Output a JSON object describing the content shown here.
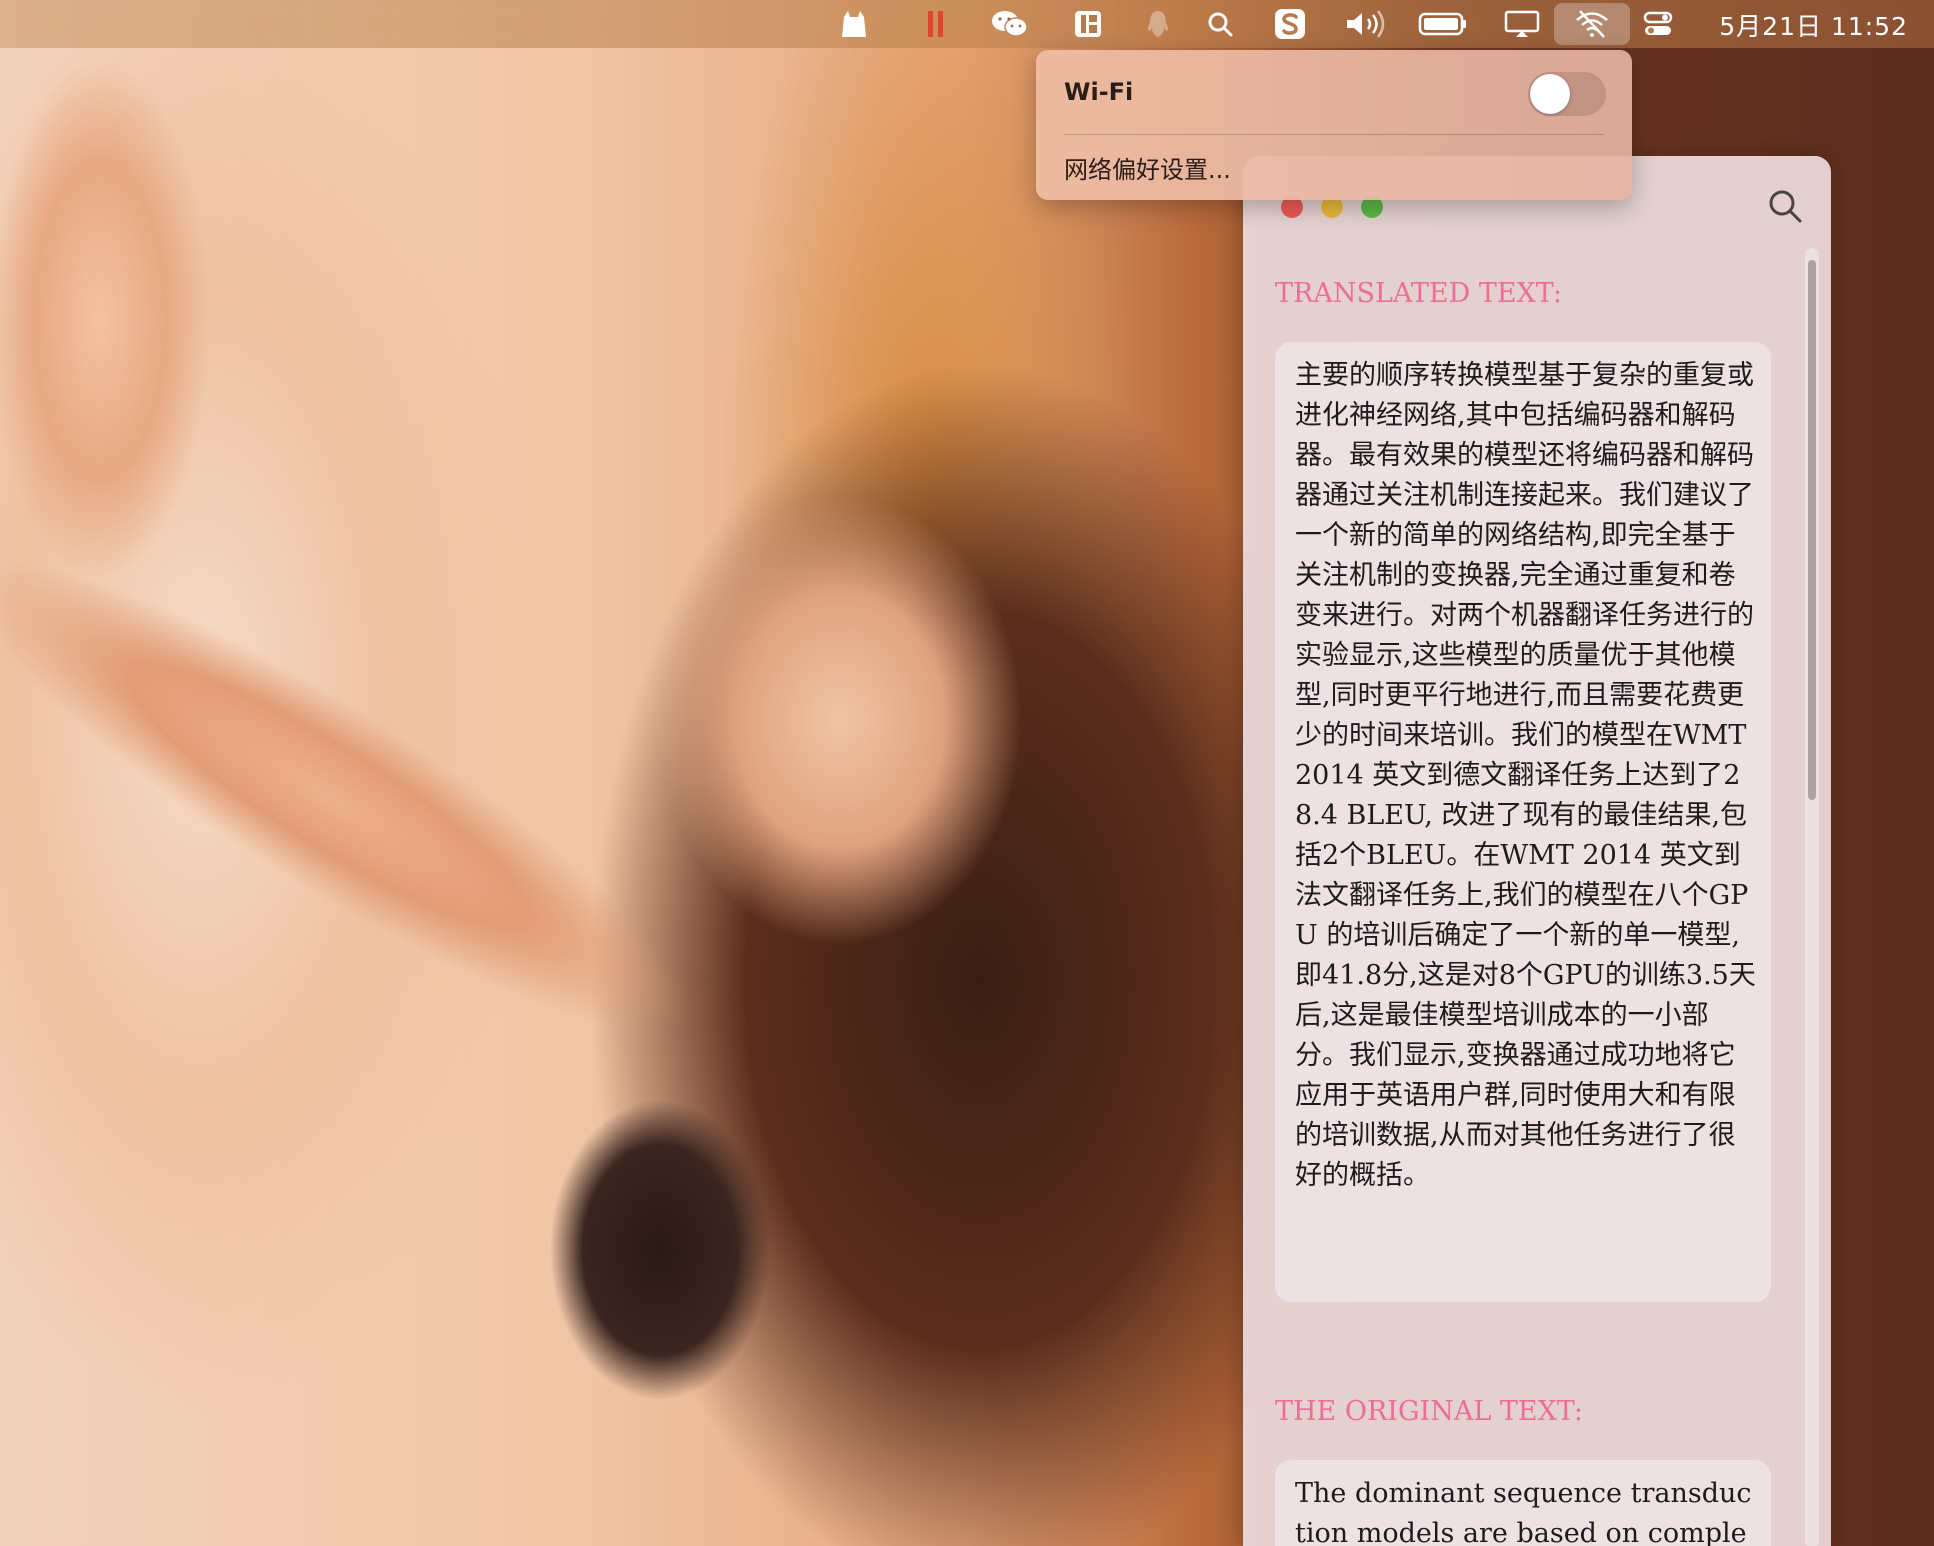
{
  "menubar": {
    "icons": [
      "app-cat-icon",
      "pause-icon",
      "wechat-icon",
      "layout-icon",
      "qq-icon",
      "search-icon",
      "sogou-icon",
      "volume-icon",
      "battery-icon",
      "display-icon",
      "wifi-off-icon",
      "control-center-icon"
    ],
    "clock": "5月21日  11:52"
  },
  "wifi_menu": {
    "title": "Wi-Fi",
    "toggle_state": "off",
    "preferences_label": "网络偏好设置..."
  },
  "window": {
    "translated_heading": "TRANSLATED TEXT:",
    "translated_text": "主要的顺序转换模型基于复杂的重复或进化神经网络,其中包括编码器和解码器。最有效果的模型还将编码器和解码器通过关注机制连接起来。我们建议了一个新的简单的网络结构,即完全基于关注机制的变换器,完全通过重复和卷变来进行。对两个机器翻译任务进行的实验显示,这些模型的质量优于其他模型,同时更平行地进行,而且需要花费更少的时间来培训。我们的模型在WMT 2014 英文到德文翻译任务上达到了28.4 BLEU, 改进了现有的最佳结果,包括2个BLEU。在WMT 2014 英文到法文翻译任务上,我们的模型在八个GPU 的培训后确定了一个新的单一模型,即41.8分,这是对8个GPU的训练3.5天后,这是最佳模型培训成本的一小部分。我们显示,变换器通过成功地将它应用于英语用户群,同时使用大和有限的培训数据,从而对其他任务进行了很好的概括。",
    "original_heading": "THE ORIGINAL TEXT:",
    "original_text": "The dominant sequence transduction models are based on complex"
  },
  "colors": {
    "heading_pink": "#ec6d97",
    "traffic_red": "#ec5b55",
    "traffic_yellow": "#e8b93a",
    "traffic_green": "#5cb747"
  }
}
